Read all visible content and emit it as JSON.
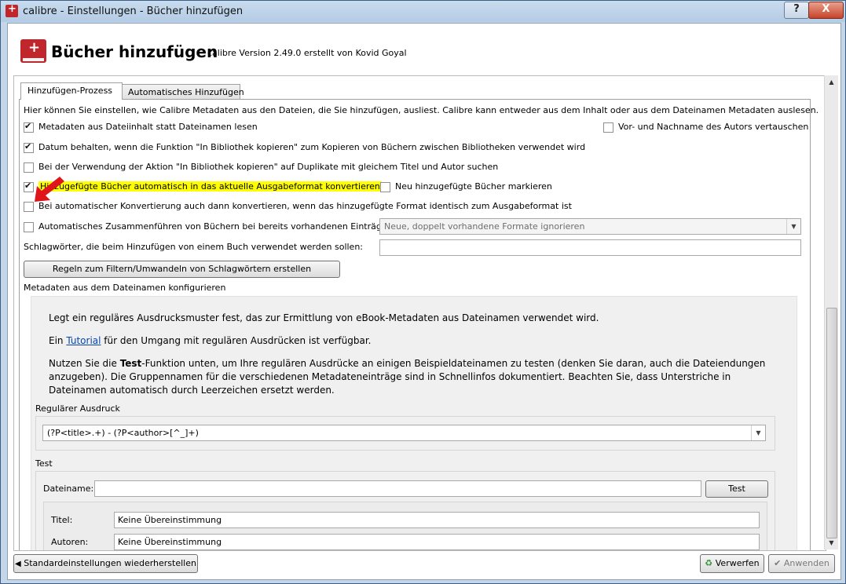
{
  "window": {
    "title": "calibre - Einstellungen - Bücher hinzufügen",
    "help_label": "?",
    "close_label": "X"
  },
  "header": {
    "title": "Bücher hinzufügen",
    "subtitle": "calibre Version 2.49.0 erstellt von Kovid Goyal"
  },
  "tabs": [
    {
      "label": "Hinzufügen-Prozess"
    },
    {
      "label": "Automatisches Hinzufügen"
    }
  ],
  "intro": "Hier können Sie einstellen, wie Calibre Metadaten aus den Dateien, die Sie hinzufügen, ausliest. Calibre kann entweder aus dem Inhalt oder aus dem Dateinamen Metadaten auslesen.",
  "options": [
    {
      "label": "Metadaten aus Dateiinhalt statt Dateinamen lesen",
      "checked": true
    },
    {
      "label": "Datum behalten, wenn die Funktion \"In Bibliothek kopieren\" zum Kopieren von Büchern zwischen Bibliotheken verwendet wird",
      "checked": true
    },
    {
      "label": "Bei der Verwendung der Aktion \"In Bibliothek kopieren\" auf Duplikate mit gleichem Titel und Autor suchen",
      "checked": false
    },
    {
      "label": "Hinzugefügte Bücher automatisch in das aktuelle Ausgabeformat konvertieren",
      "checked": true
    },
    {
      "label": "Bei automatischer Konvertierung auch dann konvertieren, wenn das hinzugefügte Format identisch zum Ausgabeformat ist",
      "checked": false
    },
    {
      "label": "Automatisches Zusammenführen von Büchern bei bereits vorhandenen Einträgen:",
      "checked": false
    }
  ],
  "option_swap_author": {
    "label": "Vor- und Nachname des Autors vertauschen",
    "checked": false
  },
  "option_mark_new": {
    "label": "Neu hinzugefügte Bücher markieren",
    "checked": false
  },
  "merge_combo": {
    "value": "Neue, doppelt vorhandene Formate ignorieren"
  },
  "tags_label": "Schlagwörter, die beim Hinzufügen von einem Buch verwendet werden sollen:",
  "tags_value": "",
  "rules_button": "Regeln zum Filtern/Umwandeln von Schlagwörtern erstellen",
  "filename_section_label": "Metadaten aus dem Dateinamen konfigurieren",
  "filename_help": {
    "line1": "Legt ein reguläres Ausdrucksmuster fest, das zur Ermittlung von eBook-Metadaten aus Dateinamen verwendet wird.",
    "line2_pre": "Ein ",
    "line2_link": "Tutorial",
    "line2_post": " für den Umgang mit regulären Ausdrücken ist verfügbar.",
    "line3_pre": "Nutzen Sie die ",
    "line3_bold": "Test",
    "line3_post": "-Funktion unten, um Ihre regulären Ausdrücke an einigen Beispieldateinamen zu testen (denken Sie daran, auch die Dateiendungen anzugeben). Die Gruppennamen für die verschiedenen Metadateneinträge sind in Schnellinfos dokumentiert. Beachten Sie, dass Unterstriche in Dateinamen automatisch durch Leerzeichen ersetzt werden."
  },
  "regex": {
    "label": "Regulärer Ausdruck",
    "value": "(?P<title>.+) - (?P<author>[^_]+)"
  },
  "test": {
    "label": "Test",
    "filename_label": "Dateiname:",
    "filename_value": "",
    "button": "Test",
    "title_label": "Titel:",
    "title_value": "Keine Übereinstimmung",
    "authors_label": "Autoren:",
    "authors_value": "Keine Übereinstimmung"
  },
  "footer": {
    "restore_button": "Standardeinstellungen wiederherstellen",
    "discard_button": "Verwerfen",
    "apply_button": "Anwenden"
  },
  "colors": {
    "highlight": "#ffff00",
    "link": "#0645ad",
    "annotation_arrow": "#e0151b"
  }
}
